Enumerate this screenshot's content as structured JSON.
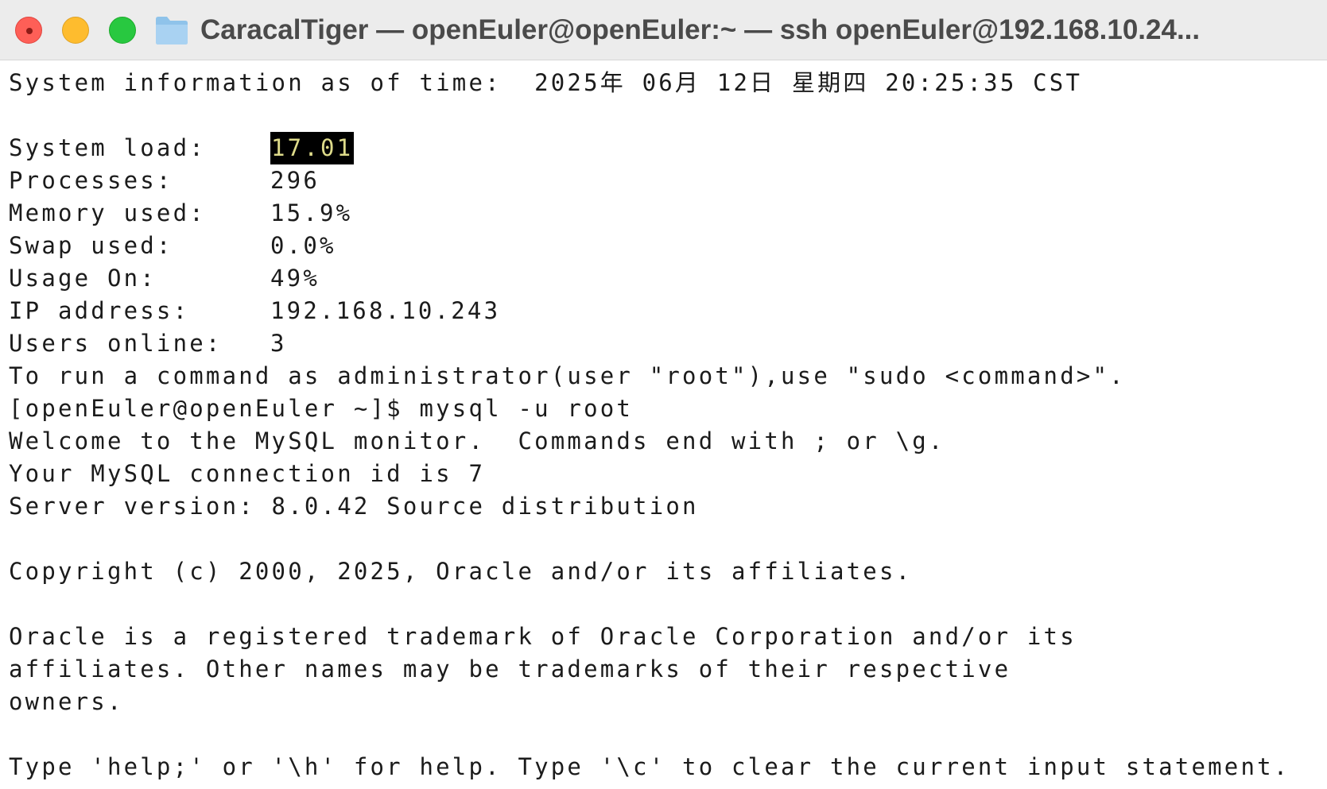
{
  "window": {
    "title": "CaracalTiger — openEuler@openEuler:~ — ssh openEuler@192.168.10.24..."
  },
  "terminal": {
    "sysinfo": "System information as of time:  2025年 06月 12日 星期四 20:25:35 CST",
    "stats": [
      {
        "label": "System load:",
        "value": "17.01"
      },
      {
        "label": "Processes:",
        "value": "296"
      },
      {
        "label": "Memory used:",
        "value": "15.9%"
      },
      {
        "label": "Swap used:",
        "value": "0.0%"
      },
      {
        "label": "Usage On:",
        "value": "49%"
      },
      {
        "label": "IP address:",
        "value": "192.168.10.243"
      },
      {
        "label": "Users online:",
        "value": "3"
      }
    ],
    "admin_hint": "To run a command as administrator(user \"root\"),use \"sudo <command>\".",
    "prompt": "[openEuler@openEuler ~]$ mysql -u root",
    "welcome": "Welcome to the MySQL monitor.  Commands end with ; or \\g.",
    "connection": "Your MySQL connection id is 7",
    "server_version": "Server version: 8.0.42 Source distribution",
    "copyright": "Copyright (c) 2000, 2025, Oracle and/or its affiliates.",
    "trademark_1": "Oracle is a registered trademark of Oracle Corporation and/or its",
    "trademark_2": "affiliates. Other names may be trademarks of their respective",
    "trademark_3": "owners.",
    "help_hint": "Type 'help;' or '\\h' for help. Type '\\c' to clear the current input statement."
  },
  "colors": {
    "close": "#fe5f57",
    "minimize": "#febc2e",
    "zoom": "#28c840",
    "highlight_bg": "#000000",
    "highlight_fg": "#dedb8a"
  },
  "icons": {
    "close": "close-icon",
    "minimize": "minimize-icon",
    "zoom": "zoom-icon",
    "folder": "folder-icon"
  }
}
